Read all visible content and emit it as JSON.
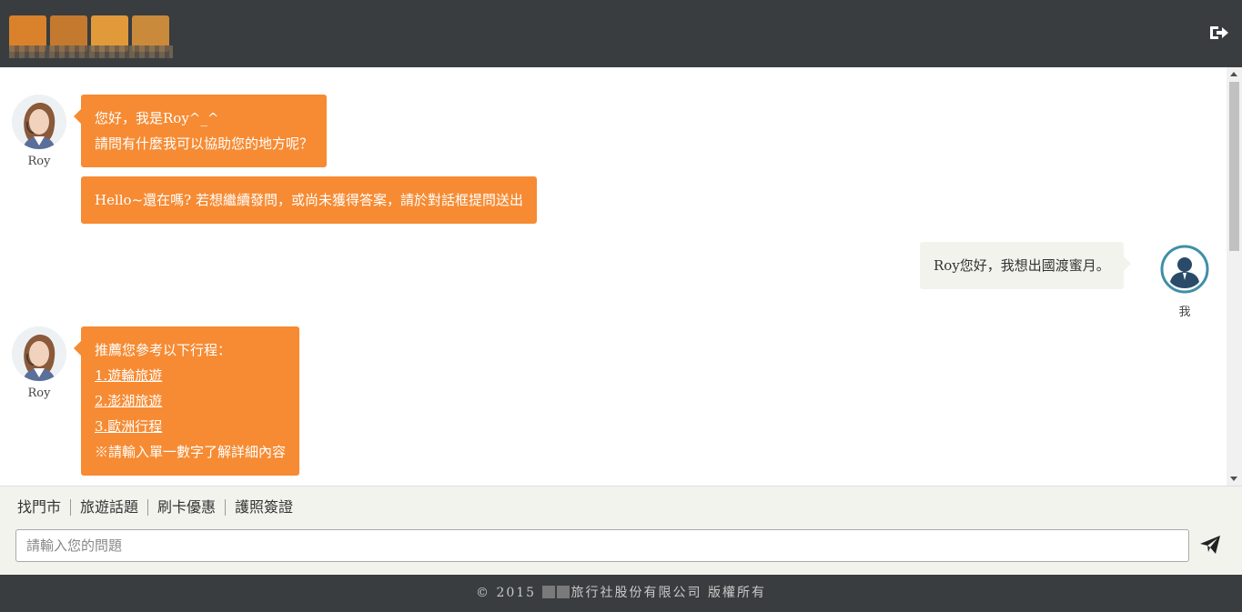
{
  "header": {
    "logo_colors": [
      "#d9822b",
      "#c47a2e",
      "#e09a3a",
      "#c98a3c"
    ],
    "logout_icon": "sign-out-icon"
  },
  "messages": [
    {
      "sender": "Roy",
      "lines": [
        "您好，我是Roy^_^",
        "請問有什麼我可以協助您的地方呢？"
      ]
    },
    {
      "sender": "Roy",
      "lines": [
        "Hello~還在嗎? 若想繼續發問，或尚未獲得答案，請於對話框提問送出"
      ]
    },
    {
      "sender": "我",
      "lines": [
        "Roy您好，我想出國渡蜜月。"
      ]
    },
    {
      "sender": "Roy",
      "lines": [
        "推薦您參考以下行程："
      ],
      "links": [
        "1.遊輪旅遊",
        "2.澎湖旅遊",
        "3.歐洲行程"
      ],
      "note": "※請輸入單一數字了解詳細內容"
    }
  ],
  "agent": {
    "name": "Roy"
  },
  "user": {
    "name": "我"
  },
  "quick_links": [
    "找門市",
    "旅遊話題",
    "刷卡優惠",
    "護照簽證"
  ],
  "input": {
    "placeholder": "請輸入您的問題",
    "value": ""
  },
  "send_icon": "paper-plane-icon",
  "footer": {
    "copyright_prefix": "© 2015",
    "copyright_suffix": "旅行社股份有限公司 版權所有"
  },
  "colors": {
    "bubble_agent": "#f68b33",
    "bubble_user": "#f3f3ee",
    "header_bg": "#3a3d3f"
  }
}
